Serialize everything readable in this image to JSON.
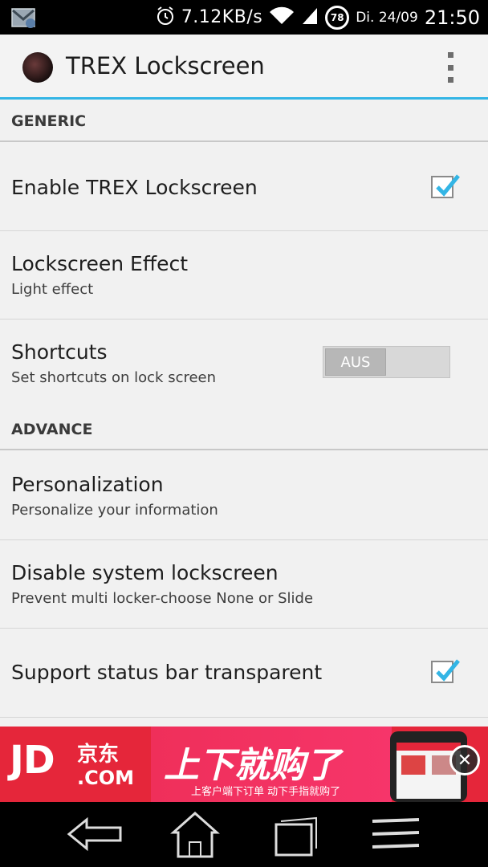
{
  "status_bar": {
    "notification_icon": "gmail-icon",
    "alarm_icon": "alarm-icon",
    "net_speed": "7.12KB/s",
    "wifi_icon": "wifi-icon",
    "signal_icon": "signal-icon",
    "battery": "78",
    "date": "Di. 24/09",
    "time": "21:50"
  },
  "action_bar": {
    "title": "TREX Lockscreen",
    "app_icon": "trex-app-icon",
    "overflow_icon": "overflow-menu-icon",
    "accent_color": "#33b5e5"
  },
  "sections": {
    "generic": {
      "label": "GENERIC"
    },
    "advance": {
      "label": "ADVANCE"
    }
  },
  "prefs": {
    "enable": {
      "title": "Enable TREX Lockscreen",
      "checked": true
    },
    "effect": {
      "title": "Lockscreen Effect",
      "summary": "Light effect"
    },
    "shortcuts": {
      "title": "Shortcuts",
      "summary": "Set shortcuts on lock screen",
      "toggle_label": "AUS",
      "toggle_on": false
    },
    "personalization": {
      "title": "Personalization",
      "summary": "Personalize your information"
    },
    "disable_system": {
      "title": "Disable system lockscreen",
      "summary": "Prevent multi locker-choose None or Slide"
    },
    "statusbar_transparent": {
      "title": "Support status bar transparent",
      "checked": true
    }
  },
  "ad": {
    "brand": "JD",
    "brand_cn": "京东",
    "brand_com": ".COM",
    "slogan": "上下就购了",
    "sub": "上客户端下订单 动下手指就购了",
    "close_label": "✕",
    "color": "#e5263a"
  },
  "nav_bar": {
    "back_icon": "back-icon",
    "home_icon": "home-icon",
    "recents_icon": "recent-apps-icon",
    "menu_icon": "menu-icon"
  }
}
